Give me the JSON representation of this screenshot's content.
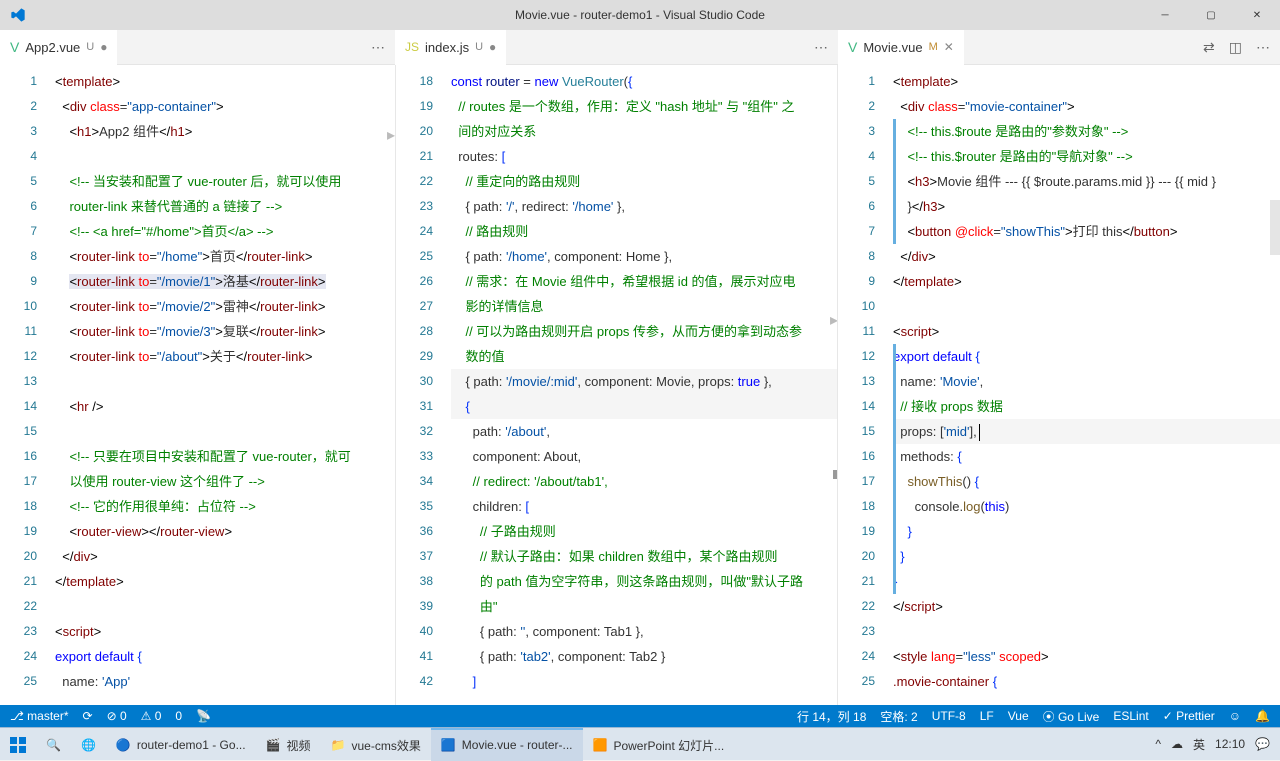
{
  "titlebar": {
    "title": "Movie.vue - router-demo1 - Visual Studio Code"
  },
  "tabs": {
    "left": {
      "icon": "V",
      "name": "App2.vue",
      "mod": "U"
    },
    "middle": {
      "icon": "JS",
      "name": "index.js",
      "mod": "U"
    },
    "right": {
      "icon": "V",
      "name": "Movie.vue",
      "mod": "M"
    }
  },
  "statusbar": {
    "branch": "master",
    "errors": "⊘ 0",
    "warnings": "⚠ 0",
    "port": "0",
    "cursor": "行 14，列 18",
    "spaces": "空格: 2",
    "encoding": "UTF-8",
    "eol": "LF",
    "lang": "Vue",
    "golive": "⦿ Go Live",
    "eslint": "ESLint",
    "prettier": "✓ Prettier",
    "bell": "🔔"
  },
  "taskbar": {
    "items": [
      {
        "name": "start",
        "label": ""
      },
      {
        "name": "search",
        "label": ""
      },
      {
        "name": "edge",
        "label": ""
      },
      {
        "name": "chrome",
        "label": "router-demo1 - Go..."
      },
      {
        "name": "media",
        "label": "视频"
      },
      {
        "name": "folder",
        "label": "vue-cms效果"
      },
      {
        "name": "vscode",
        "label": "Movie.vue - router-..."
      },
      {
        "name": "ppt",
        "label": "PowerPoint 幻灯片..."
      }
    ],
    "tray": {
      "ime": "英",
      "time": "12:10"
    }
  },
  "pane1": {
    "start": 1,
    "html": [
      "<span class='t-punc'>&lt;</span><span class='t-tag'>template</span><span class='t-punc'>&gt;</span>",
      "  <span class='t-punc'>&lt;</span><span class='t-tag'>div</span> <span class='t-attr'>class</span>=<span class='t-str'>\"app-container\"</span><span class='t-punc'>&gt;</span>",
      "    <span class='t-punc'>&lt;</span><span class='t-tag'>h1</span><span class='t-punc'>&gt;</span>App2 组件<span class='t-punc'>&lt;/</span><span class='t-tag'>h1</span><span class='t-punc'>&gt;</span>",
      "",
      "    <span class='t-cmt'>&lt;!-- 当安装和配置了 vue-router 后，就可以使用</span>",
      "    <span class='t-cmt'>router-link 来替代普通的 a 链接了 --&gt;</span>",
      "    <span class='t-cmt'>&lt;!-- &lt;a href=\"#/home\"&gt;首页&lt;/a&gt; --&gt;</span>",
      "    <span class='t-punc'>&lt;</span><span class='t-tag'>router-link</span> <span class='t-attr'>to</span>=<span class='t-str'>\"/home\"</span><span class='t-punc'>&gt;</span>首页<span class='t-punc'>&lt;/</span><span class='t-tag'>router-link</span><span class='t-punc'>&gt;</span>",
      "    <span class='hl1'><span class='t-punc'>&lt;</span><span class='t-tag'>router-link</span> <span class='t-attr'>to</span>=<span class='t-str'>\"/movie/1\"</span><span class='t-punc'>&gt;</span>洛基<span class='t-punc'>&lt;/</span><span class='t-tag'>router-link</span><span class='t-punc'>&gt;</span></span>",
      "    <span class='t-punc'>&lt;</span><span class='t-tag'>router-link</span> <span class='t-attr'>to</span>=<span class='t-str'>\"/movie/2\"</span><span class='t-punc'>&gt;</span>雷神<span class='t-punc'>&lt;/</span><span class='t-tag'>router-link</span><span class='t-punc'>&gt;</span>",
      "    <span class='t-punc'>&lt;</span><span class='t-tag'>router-link</span> <span class='t-attr'>to</span>=<span class='t-str'>\"/movie/3\"</span><span class='t-punc'>&gt;</span>复联<span class='t-punc'>&lt;/</span><span class='t-tag'>router-link</span><span class='t-punc'>&gt;</span>",
      "    <span class='t-punc'>&lt;</span><span class='t-tag'>router-link</span> <span class='t-attr'>to</span>=<span class='t-str'>\"/about\"</span><span class='t-punc'>&gt;</span>关于<span class='t-punc'>&lt;/</span><span class='t-tag'>router-link</span><span class='t-punc'>&gt;</span>",
      "",
      "    <span class='t-punc'>&lt;</span><span class='t-tag'>hr</span> <span class='t-punc'>/&gt;</span>",
      "",
      "    <span class='t-cmt'>&lt;!-- 只要在项目中安装和配置了 vue-router，就可</span>",
      "    <span class='t-cmt'>以使用 router-view 这个组件了 --&gt;</span>",
      "    <span class='t-cmt'>&lt;!-- 它的作用很单纯：占位符 --&gt;</span>",
      "    <span class='t-punc'>&lt;</span><span class='t-tag'>router-view</span><span class='t-punc'>&gt;&lt;/</span><span class='t-tag'>router-view</span><span class='t-punc'>&gt;</span>",
      "  <span class='t-punc'>&lt;/</span><span class='t-tag'>div</span><span class='t-punc'>&gt;</span>",
      "<span class='t-punc'>&lt;/</span><span class='t-tag'>template</span><span class='t-punc'>&gt;</span>",
      "",
      "<span class='t-punc'>&lt;</span><span class='t-tag'>script</span><span class='t-punc'>&gt;</span>",
      "<span class='t-kw'>export</span> <span class='t-kw'>default</span> <span class='t-br'>{</span>",
      "  name: <span class='t-str'>'App'</span>"
    ]
  },
  "pane2": {
    "start": 18,
    "html": [
      "<span class='t-kw'>const</span> <span class='t-prop'>router</span> = <span class='t-kw'>new</span> <span class='t-new'>VueRouter</span>(<span class='t-br'>{</span>",
      "  <span class='t-cmt'>// routes 是一个数组，作用：定义 \"hash 地址\" 与 \"组件\" 之</span>",
      "  <span class='t-cmt'>间的对应关系</span>",
      "  routes: <span class='t-br'>[</span>",
      "    <span class='t-cmt'>// 重定向的路由规则</span>",
      "    { path: <span class='t-str'>'/'</span>, redirect: <span class='t-str'>'/home'</span> },",
      "    <span class='t-cmt'>// 路由规则</span>",
      "    { path: <span class='t-str'>'/home'</span>, component: Home },",
      "    <span class='t-cmt'>// 需求：在 Movie 组件中，希望根据 id 的值，展示对应电</span>",
      "    <span class='t-cmt'>影的详情信息</span>",
      "    <span class='t-cmt'>// 可以为路由规则开启 props 传参，从而方便的拿到动态参</span>",
      "    <span class='t-cmt'>数的值</span>",
      "    { path: <span class='t-str'>'/movie/:mid'</span>, component: Movie, props: <span class='t-kw'>true</span> },",
      "    <span class='t-br'>{</span>",
      "      path: <span class='t-str'>'/about'</span>,",
      "      component: About,",
      "      <span class='t-cmt'>// redirect: '/about/tab1',</span>",
      "      children: <span class='t-br'>[</span>",
      "        <span class='t-cmt'>// 子路由规则</span>",
      "        <span class='t-cmt'>// 默认子路由：如果 children 数组中，某个路由规则</span>",
      "        <span class='t-cmt'>的 path 值为空字符串，则这条路由规则，叫做\"默认子路</span>",
      "        <span class='t-cmt'>由\"</span>",
      "        { path: <span class='t-str'>''</span>, component: Tab1 },",
      "        { path: <span class='t-str'>'tab2'</span>, component: Tab2 }",
      "      <span class='t-br'>]</span>"
    ]
  },
  "pane3": {
    "start": 1,
    "html": [
      "<span class='t-punc'>&lt;</span><span class='t-tag'>template</span><span class='t-punc'>&gt;</span>",
      "  <span class='t-punc'>&lt;</span><span class='t-tag'>div</span> <span class='t-attr'>class</span>=<span class='t-str'>\"movie-container\"</span><span class='t-punc'>&gt;</span>",
      "    <span class='t-cmt'>&lt;!-- this.$route 是路由的\"参数对象\" --&gt;</span>",
      "    <span class='t-cmt'>&lt;!-- this.$router 是路由的\"导航对象\" --&gt;</span>",
      "    <span class='t-punc'>&lt;</span><span class='t-tag'>h3</span><span class='t-punc'>&gt;</span>Movie 组件 --- {{ $route.params.mid }} --- {{ mid }",
      "    }<span class='t-punc'>&lt;/</span><span class='t-tag'>h3</span><span class='t-punc'>&gt;</span>",
      "    <span class='t-punc'>&lt;</span><span class='t-tag'>button</span> <span class='t-attr'>@click</span>=<span class='t-str'>\"showThis\"</span><span class='t-punc'>&gt;</span>打印 this<span class='t-punc'>&lt;/</span><span class='t-tag'>button</span><span class='t-punc'>&gt;</span>",
      "  <span class='t-punc'>&lt;/</span><span class='t-tag'>div</span><span class='t-punc'>&gt;</span>",
      "<span class='t-punc'>&lt;/</span><span class='t-tag'>template</span><span class='t-punc'>&gt;</span>",
      "",
      "<span class='t-punc'>&lt;</span><span class='t-tag'>script</span><span class='t-punc'>&gt;</span>",
      "<span class='t-kw'>export</span> <span class='t-kw'>default</span> <span class='t-br'>{</span>",
      "  name: <span class='t-str'>'Movie'</span>,",
      "  <span class='t-cmt'>// 接收 props 数据</span>",
      "  props: [<span class='t-str'>'mid'</span>],<span class='caret'></span>",
      "  methods: <span class='t-br'>{</span>",
      "    <span class='t-fn'>showThis</span>() <span class='t-br'>{</span>",
      "      console.<span class='t-fn'>log</span>(<span class='t-kw'>this</span>)",
      "    <span class='t-br'>}</span>",
      "  <span class='t-br'>}</span>",
      "<span class='t-br'>}</span>",
      "<span class='t-punc'>&lt;/</span><span class='t-tag'>script</span><span class='t-punc'>&gt;</span>",
      "",
      "<span class='t-punc'>&lt;</span><span class='t-tag'>style</span> <span class='t-attr'>lang</span>=<span class='t-str'>\"less\"</span> <span class='t-attr'>scoped</span><span class='t-punc'>&gt;</span>",
      "<span class='t-tag'>.movie-container</span> <span class='t-br'>{</span>"
    ]
  }
}
